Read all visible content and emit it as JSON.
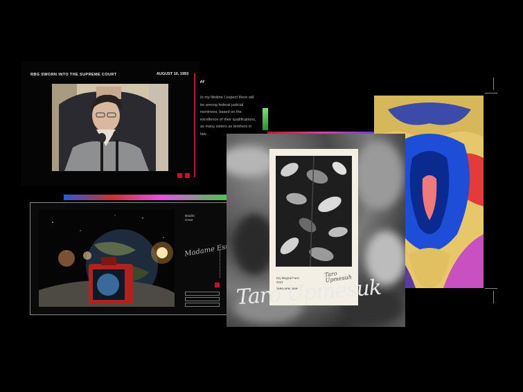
{
  "rbg": {
    "title": "RBG SWORN INTO THE SUPREME COURT",
    "date": "AUGUST 10, 1993",
    "quote_mark": "“",
    "quote": "In my lifetime I expect there will be among federal judicial nominees, based on the excellence of their qualifications, as many sisters as brothers in law."
  },
  "space": {
    "side_label": "Brazilic\nCreat",
    "signature": "Madame Esmin",
    "fields": [
      "",
      "",
      ""
    ]
  },
  "plant": {
    "caption": "Dry Magical Farm\n2023",
    "small_signature": "Taro\nUpmesuh",
    "small_text": "TARO UPMESUH",
    "big_signature": "Taro Upmesuk"
  },
  "colors": {
    "accent_red": "#c8102e",
    "background": "#000000"
  }
}
